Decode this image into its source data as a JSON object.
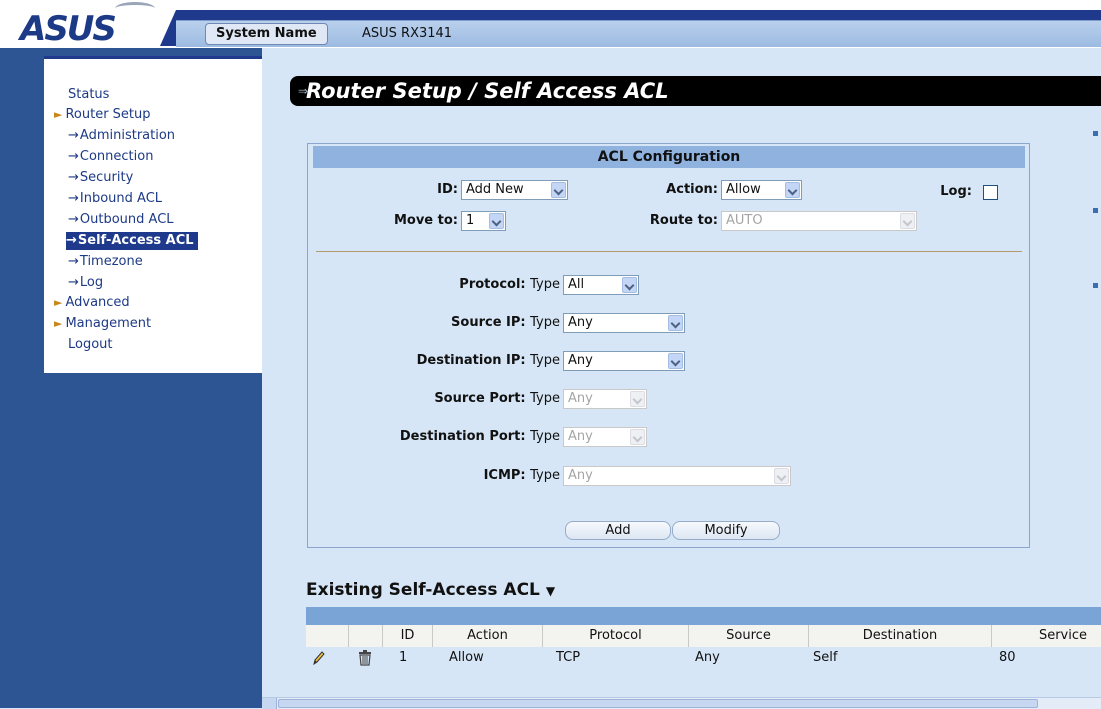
{
  "header": {
    "logo_text": "ASUS",
    "system_name_label": "System Name",
    "system_name_value": "ASUS RX3141"
  },
  "nav": {
    "items": [
      {
        "label": "Status",
        "kind": "top"
      },
      {
        "label": "Router Setup",
        "kind": "group"
      },
      {
        "label": "Administration",
        "kind": "sub"
      },
      {
        "label": "Connection",
        "kind": "sub"
      },
      {
        "label": "Security",
        "kind": "sub"
      },
      {
        "label": "Inbound ACL",
        "kind": "sub"
      },
      {
        "label": "Outbound ACL",
        "kind": "sub"
      },
      {
        "label": "Self-Access ACL",
        "kind": "sub",
        "active": true
      },
      {
        "label": "Timezone",
        "kind": "sub"
      },
      {
        "label": "Log",
        "kind": "sub"
      },
      {
        "label": "Advanced",
        "kind": "group"
      },
      {
        "label": "Management",
        "kind": "group"
      },
      {
        "label": "Logout",
        "kind": "top"
      }
    ]
  },
  "page_title": "Router Setup / Self Access ACL",
  "acl_config": {
    "heading": "ACL Configuration",
    "id_label": "ID:",
    "id_value": "Add New",
    "action_label": "Action:",
    "action_value": "Allow",
    "log_label": "Log:",
    "log_checked": false,
    "move_to_label": "Move to:",
    "move_to_value": "1",
    "route_to_label": "Route to:",
    "route_to_value": "AUTO",
    "type_word": "Type",
    "protocol_label": "Protocol:",
    "protocol_value": "All",
    "source_ip_label": "Source IP:",
    "source_ip_value": "Any",
    "dest_ip_label": "Destination IP:",
    "dest_ip_value": "Any",
    "source_port_label": "Source Port:",
    "source_port_value": "Any",
    "dest_port_label": "Destination Port:",
    "dest_port_value": "Any",
    "icmp_label": "ICMP:",
    "icmp_value": "Any",
    "add_button": "Add",
    "modify_button": "Modify"
  },
  "existing": {
    "title": "Existing Self-Access ACL",
    "columns": [
      "ID",
      "Action",
      "Protocol",
      "Source",
      "Destination",
      "Service"
    ],
    "rows": [
      {
        "id": "1",
        "action": "Allow",
        "protocol": "TCP",
        "source": "Any",
        "destination": "Self",
        "service": "80"
      }
    ]
  },
  "colors": {
    "nav_dark": "#2d5593",
    "accent_blue": "#1f3a8c",
    "panel_bg": "#d6e6f6",
    "panel_header": "#8fb2de"
  },
  "icons": [
    "edit-pencil-icon",
    "delete-trash-icon",
    "dropdown-arrow-icon",
    "triangle-bullet-icon"
  ]
}
